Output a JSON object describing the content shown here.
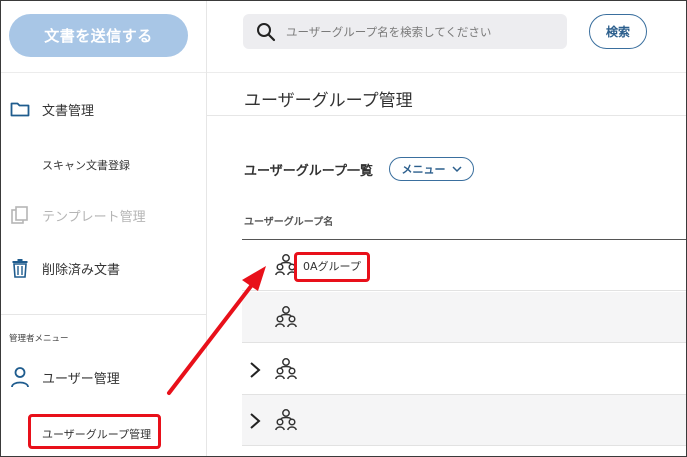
{
  "sidebar": {
    "send_button": "文書を送信する",
    "items": [
      {
        "label": "文書管理",
        "icon": "folder-icon"
      },
      {
        "label": "スキャン文書登録"
      },
      {
        "label": "テンプレート管理",
        "icon": "template-copy-icon"
      },
      {
        "label": "削除済み文書",
        "icon": "trash-icon"
      }
    ],
    "admin_section_label": "管理者メニュー",
    "admin_items": [
      {
        "label": "ユーザー管理",
        "icon": "user-icon"
      },
      {
        "label": "ユーザーグループ管理"
      }
    ]
  },
  "topbar": {
    "search_placeholder": "ユーザーグループ名を検索してください",
    "search_button": "検索"
  },
  "main": {
    "page_title": "ユーザーグループ管理",
    "list_title": "ユーザーグループ一覧",
    "menu_button": "メニュー",
    "column_header": "ユーザーグループ名",
    "rows": [
      {
        "name": "0Aグループ",
        "expandable": false
      },
      {
        "name": "",
        "expandable": false
      },
      {
        "name": "",
        "expandable": true
      },
      {
        "name": "",
        "expandable": true
      }
    ]
  },
  "colors": {
    "accent": "#2c5f8d",
    "send_button_bg": "#a8c6e6",
    "highlight": "#e8101a"
  }
}
